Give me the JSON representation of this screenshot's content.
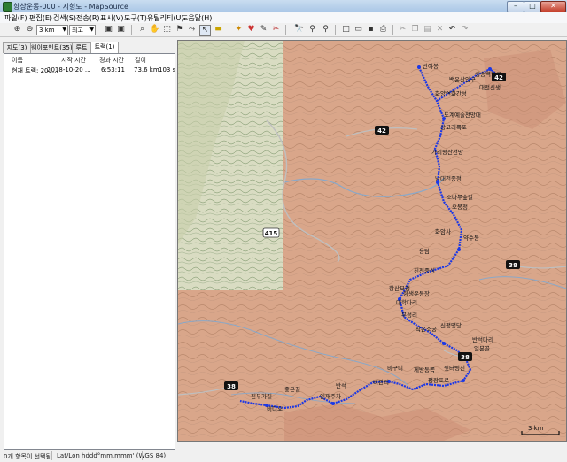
{
  "window": {
    "title": "항상운동-000 - 지형도 - MapSource"
  },
  "menu": [
    "파일(F)",
    "편집(E)",
    "검색(S)",
    "전송(R)",
    "표시(V)",
    "도구(T)",
    "유틸리티(U)",
    "도움말(H)"
  ],
  "toolbar": {
    "zoom_value": "3 km",
    "detail_value": "최고"
  },
  "tabs": [
    "지도(3)",
    "웨이포인트(35)",
    "루트",
    "트랙(1)"
  ],
  "track_table": {
    "columns": [
      "이름",
      "시작 시간",
      "경과 시간",
      "길이"
    ],
    "rows": [
      [
        "현재 트랙: 201...",
        "2018-10-20 ...",
        "6:53:11",
        "73.6 km",
        "103 s"
      ]
    ]
  },
  "map": {
    "road_badges": [
      "42",
      "42",
      "415",
      "38",
      "38",
      "38"
    ],
    "scale_label": "3 km",
    "waypoint_labels": [
      "반야봉",
      "백운산입구",
      "성송역입구",
      "화양연화간성",
      "대전신생",
      "도계예술전망대",
      "상고리폭포",
      "가리왕산전망",
      "남대천종점",
      "소나무숲길",
      "오봉정",
      "화암사",
      "약수동",
      "용담",
      "진전중심",
      "항산모정",
      "대학다리",
      "부성리",
      "작은소궁",
      "신평명당",
      "항생운동장",
      "반석다리",
      "일본골",
      "제방동쪽",
      "윗터빙진",
      "평장포로",
      "비관리",
      "비구니",
      "반석",
      "인재주차",
      "좋은길",
      "진부가길",
      "비디오"
    ]
  },
  "status": {
    "selection": "0개 항목이 선택됨",
    "coords": "Lat/Lon hddd°mm.mmm' (WGS 84)"
  }
}
